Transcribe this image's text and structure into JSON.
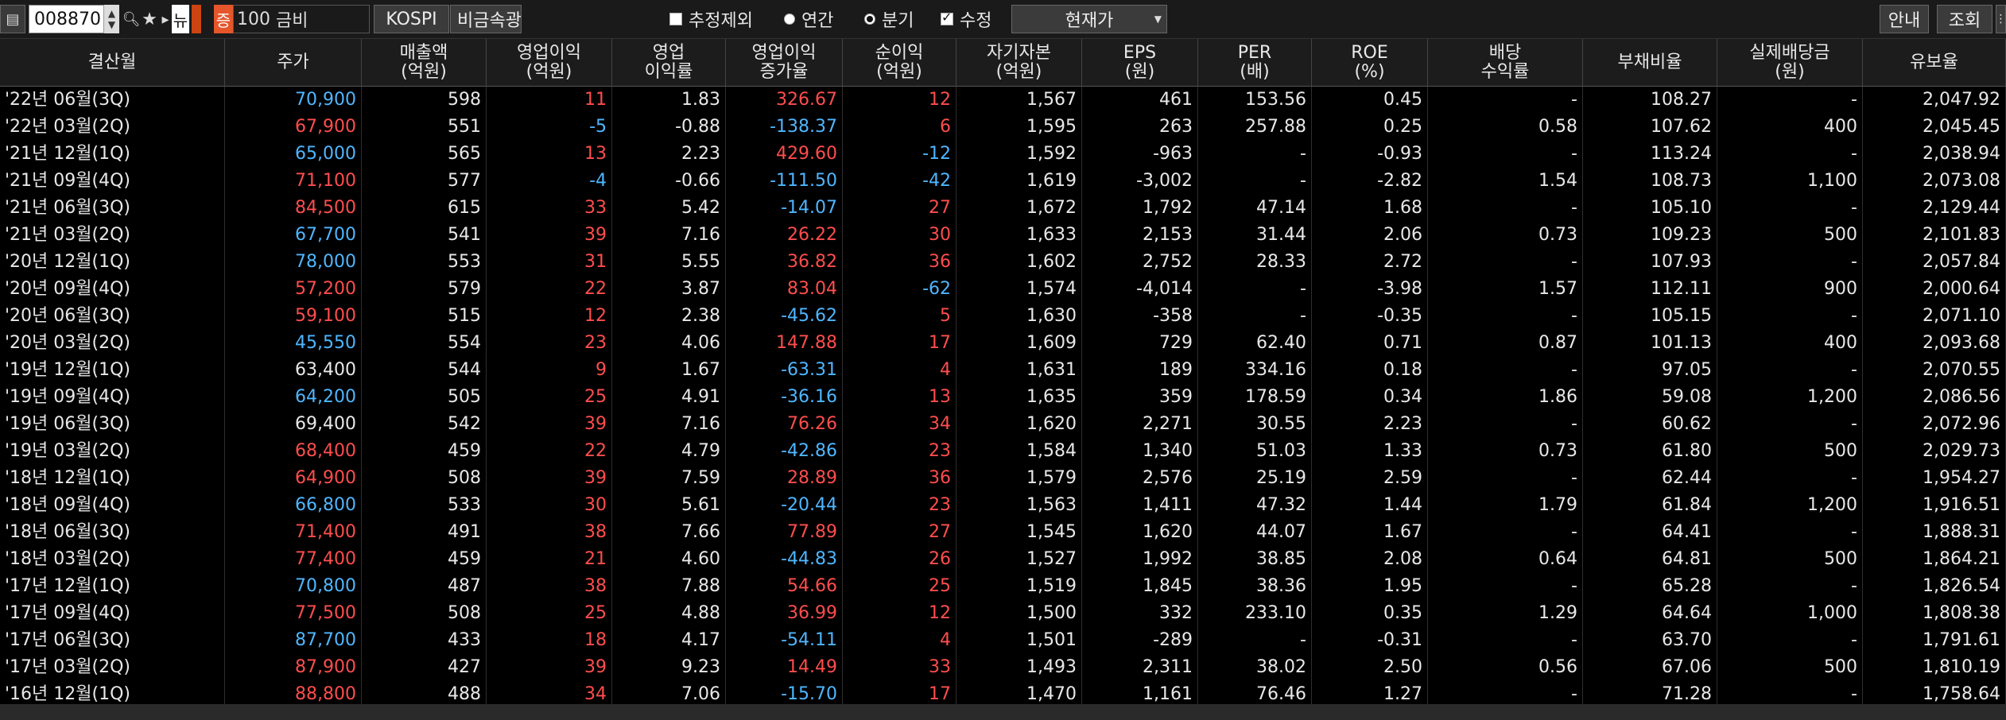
{
  "toolbar": {
    "code": "008870",
    "nyu": "뉴",
    "badge": "증",
    "margin": "100",
    "name": "금비",
    "market": "KOSPI",
    "sector": "비금속광물",
    "exclude_estimate": "추정제외",
    "annual": "연간",
    "quarterly": "분기",
    "adjusted": "수정",
    "price_mode": "현재가",
    "guide": "안내",
    "query": "조회"
  },
  "columns": [
    [
      "결산월"
    ],
    [
      "주가"
    ],
    [
      "매출액",
      "(억원)"
    ],
    [
      "영업이익",
      "(억원)"
    ],
    [
      "영업",
      "이익률"
    ],
    [
      "영업이익",
      "증가율"
    ],
    [
      "순이익",
      "(억원)"
    ],
    [
      "자기자본",
      "(억원)"
    ],
    [
      "EPS",
      "(원)"
    ],
    [
      "PER",
      "(배)"
    ],
    [
      "ROE",
      "(%)"
    ],
    [
      "배당",
      "수익률"
    ],
    [
      "부채비율"
    ],
    [
      "실제배당금",
      "(원)"
    ],
    [
      "유보율"
    ]
  ],
  "rows": [
    [
      "'22년 06월(3Q)",
      "70,900",
      "598",
      "11",
      "1.83",
      "326.67",
      "12",
      "1,567",
      "461",
      "153.56",
      "0.45",
      "-",
      "108.27",
      "-",
      "2,047.92"
    ],
    [
      "'22년 03월(2Q)",
      "67,900",
      "551",
      "-5",
      "-0.88",
      "-138.37",
      "6",
      "1,595",
      "263",
      "257.88",
      "0.25",
      "0.58",
      "107.62",
      "400",
      "2,045.45"
    ],
    [
      "'21년 12월(1Q)",
      "65,000",
      "565",
      "13",
      "2.23",
      "429.60",
      "-12",
      "1,592",
      "-963",
      "-",
      "-0.93",
      "-",
      "113.24",
      "-",
      "2,038.94"
    ],
    [
      "'21년 09월(4Q)",
      "71,100",
      "577",
      "-4",
      "-0.66",
      "-111.50",
      "-42",
      "1,619",
      "-3,002",
      "-",
      "-2.82",
      "1.54",
      "108.73",
      "1,100",
      "2,073.08"
    ],
    [
      "'21년 06월(3Q)",
      "84,500",
      "615",
      "33",
      "5.42",
      "-14.07",
      "27",
      "1,672",
      "1,792",
      "47.14",
      "1.68",
      "-",
      "105.10",
      "-",
      "2,129.44"
    ],
    [
      "'21년 03월(2Q)",
      "67,700",
      "541",
      "39",
      "7.16",
      "26.22",
      "30",
      "1,633",
      "2,153",
      "31.44",
      "2.06",
      "0.73",
      "109.23",
      "500",
      "2,101.83"
    ],
    [
      "'20년 12월(1Q)",
      "78,000",
      "553",
      "31",
      "5.55",
      "36.82",
      "36",
      "1,602",
      "2,752",
      "28.33",
      "2.72",
      "-",
      "107.93",
      "-",
      "2,057.84"
    ],
    [
      "'20년 09월(4Q)",
      "57,200",
      "579",
      "22",
      "3.87",
      "83.04",
      "-62",
      "1,574",
      "-4,014",
      "-",
      "-3.98",
      "1.57",
      "112.11",
      "900",
      "2,000.64"
    ],
    [
      "'20년 06월(3Q)",
      "59,100",
      "515",
      "12",
      "2.38",
      "-45.62",
      "5",
      "1,630",
      "-358",
      "-",
      "-0.35",
      "-",
      "105.15",
      "-",
      "2,071.10"
    ],
    [
      "'20년 03월(2Q)",
      "45,550",
      "554",
      "23",
      "4.06",
      "147.88",
      "17",
      "1,609",
      "729",
      "62.40",
      "0.71",
      "0.87",
      "101.13",
      "400",
      "2,093.68"
    ],
    [
      "'19년 12월(1Q)",
      "63,400",
      "544",
      "9",
      "1.67",
      "-63.31",
      "4",
      "1,631",
      "189",
      "334.16",
      "0.18",
      "-",
      "97.05",
      "-",
      "2,070.55"
    ],
    [
      "'19년 09월(4Q)",
      "64,200",
      "505",
      "25",
      "4.91",
      "-36.16",
      "13",
      "1,635",
      "359",
      "178.59",
      "0.34",
      "1.86",
      "59.08",
      "1,200",
      "2,086.56"
    ],
    [
      "'19년 06월(3Q)",
      "69,400",
      "542",
      "39",
      "7.16",
      "76.26",
      "34",
      "1,620",
      "2,271",
      "30.55",
      "2.23",
      "-",
      "60.62",
      "-",
      "2,072.96"
    ],
    [
      "'19년 03월(2Q)",
      "68,400",
      "459",
      "22",
      "4.79",
      "-42.86",
      "23",
      "1,584",
      "1,340",
      "51.03",
      "1.33",
      "0.73",
      "61.80",
      "500",
      "2,029.73"
    ],
    [
      "'18년 12월(1Q)",
      "64,900",
      "508",
      "39",
      "7.59",
      "28.89",
      "36",
      "1,579",
      "2,576",
      "25.19",
      "2.59",
      "-",
      "62.44",
      "-",
      "1,954.27"
    ],
    [
      "'18년 09월(4Q)",
      "66,800",
      "533",
      "30",
      "5.61",
      "-20.44",
      "23",
      "1,563",
      "1,411",
      "47.32",
      "1.44",
      "1.79",
      "61.84",
      "1,200",
      "1,916.51"
    ],
    [
      "'18년 06월(3Q)",
      "71,400",
      "491",
      "38",
      "7.66",
      "77.89",
      "27",
      "1,545",
      "1,620",
      "44.07",
      "1.67",
      "-",
      "64.41",
      "-",
      "1,888.31"
    ],
    [
      "'18년 03월(2Q)",
      "77,400",
      "459",
      "21",
      "4.60",
      "-44.83",
      "26",
      "1,527",
      "1,992",
      "38.85",
      "2.08",
      "0.64",
      "64.81",
      "500",
      "1,864.21"
    ],
    [
      "'17년 12월(1Q)",
      "70,800",
      "487",
      "38",
      "7.88",
      "54.66",
      "25",
      "1,519",
      "1,845",
      "38.36",
      "1.95",
      "-",
      "65.28",
      "-",
      "1,826.54"
    ],
    [
      "'17년 09월(4Q)",
      "77,500",
      "508",
      "25",
      "4.88",
      "36.99",
      "12",
      "1,500",
      "332",
      "233.10",
      "0.35",
      "1.29",
      "64.64",
      "1,000",
      "1,808.38"
    ],
    [
      "'17년 06월(3Q)",
      "87,700",
      "433",
      "18",
      "4.17",
      "-54.11",
      "4",
      "1,501",
      "-289",
      "-",
      "-0.31",
      "-",
      "63.70",
      "-",
      "1,791.61"
    ],
    [
      "'17년 03월(2Q)",
      "87,900",
      "427",
      "39",
      "9.23",
      "14.49",
      "33",
      "1,493",
      "2,311",
      "38.02",
      "2.50",
      "0.56",
      "67.06",
      "500",
      "1,810.19"
    ],
    [
      "'16년 12월(1Q)",
      "88,800",
      "488",
      "34",
      "7.06",
      "-15.70",
      "17",
      "1,470",
      "1,161",
      "76.46",
      "1.27",
      "-",
      "71.28",
      "-",
      "1,758.64"
    ]
  ],
  "price_colors": [
    "dn",
    "up",
    "dn",
    "up",
    "up",
    "dn",
    "dn",
    "up",
    "up",
    "dn",
    "wh",
    "dn",
    "wh",
    "up",
    "up",
    "dn",
    "up",
    "up",
    "dn",
    "up",
    "dn",
    "up",
    "up"
  ],
  "colors": {
    "up": "#ff4d4d",
    "down": "#4fb6ff",
    "header_bg": "#1c1c1c",
    "bg": "#000000"
  }
}
